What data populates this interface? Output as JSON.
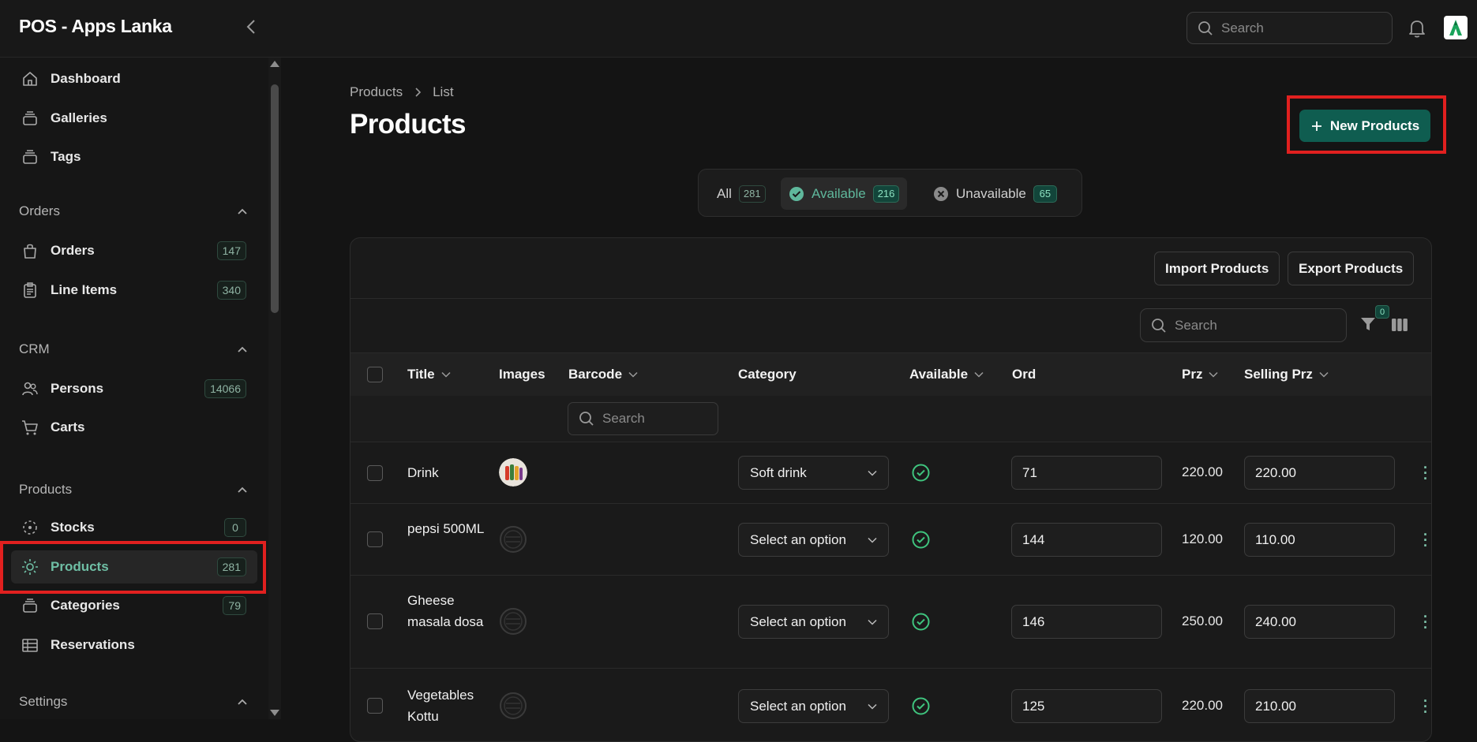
{
  "app": {
    "title": "POS - Apps Lanka"
  },
  "topbar": {
    "search_placeholder": "Search"
  },
  "sidebar": {
    "items": [
      {
        "label": "Dashboard",
        "icon": "home-icon"
      },
      {
        "label": "Galleries",
        "icon": "stack-icon"
      },
      {
        "label": "Tags",
        "icon": "stack-icon"
      }
    ],
    "groups": [
      {
        "label": "Orders",
        "items": [
          {
            "label": "Orders",
            "badge": "147",
            "icon": "bag-icon"
          },
          {
            "label": "Line Items",
            "badge": "340",
            "icon": "clipboard-icon"
          }
        ]
      },
      {
        "label": "CRM",
        "items": [
          {
            "label": "Persons",
            "badge": "14066",
            "icon": "users-icon"
          },
          {
            "label": "Carts",
            "icon": "cart-icon"
          }
        ]
      },
      {
        "label": "Products",
        "items": [
          {
            "label": "Stocks",
            "badge": "0",
            "icon": "dashed-circle-icon"
          },
          {
            "label": "Products",
            "badge": "281",
            "icon": "sun-icon",
            "active": true
          },
          {
            "label": "Categories",
            "badge": "79",
            "icon": "stack-icon"
          },
          {
            "label": "Reservations",
            "icon": "table-icon"
          }
        ]
      },
      {
        "label": "Settings",
        "items": []
      }
    ]
  },
  "page": {
    "breadcrumb": [
      "Products",
      "List"
    ],
    "title": "Products",
    "new_button": "New Products"
  },
  "tabs": [
    {
      "label": "All",
      "count": "281"
    },
    {
      "label": "Available",
      "count": "216",
      "active": true
    },
    {
      "label": "Unavailable",
      "count": "65"
    }
  ],
  "toolbar": {
    "import_label": "Import Products",
    "export_label": "Export Products",
    "search_placeholder": "Search",
    "filter_count": "0"
  },
  "table": {
    "columns": [
      "Title",
      "Images",
      "Barcode",
      "Category",
      "Available",
      "Ord",
      "Prz",
      "Selling Prz"
    ],
    "barcode_search_placeholder": "Search",
    "rows": [
      {
        "title": "Drink",
        "category": "Soft drink",
        "available": true,
        "ord": "71",
        "prz": "220.00",
        "selling_prz": "220.00"
      },
      {
        "title": "pepsi 500ML",
        "category": "Select an option",
        "available": true,
        "ord": "144",
        "prz": "120.00",
        "selling_prz": "110.00"
      },
      {
        "title": "Gheese masala dosa",
        "category": "Select an option",
        "available": true,
        "ord": "146",
        "prz": "250.00",
        "selling_prz": "240.00"
      },
      {
        "title": "Vegetables Kottu",
        "category": "Select an option",
        "available": true,
        "ord": "125",
        "prz": "220.00",
        "selling_prz": "210.00"
      }
    ]
  },
  "colors": {
    "accent": "#0f5d50",
    "accent_text": "#6fbfa5",
    "highlight": "#e1201f",
    "success": "#3fc47e"
  }
}
